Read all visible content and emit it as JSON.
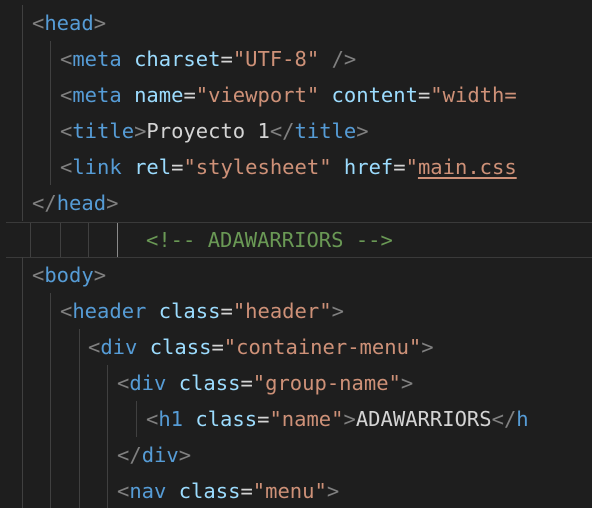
{
  "editor": {
    "lines": [
      [
        [
          "punct",
          "<"
        ],
        [
          "tag",
          "head"
        ],
        [
          "punct",
          ">"
        ]
      ],
      [
        [
          "punct",
          "<"
        ],
        [
          "tag",
          "meta"
        ],
        [
          "text",
          " "
        ],
        [
          "attr",
          "charset"
        ],
        [
          "eq",
          "="
        ],
        [
          "str",
          "\"UTF-8\""
        ],
        [
          "text",
          " "
        ],
        [
          "punct",
          "/>"
        ]
      ],
      [
        [
          "punct",
          "<"
        ],
        [
          "tag",
          "meta"
        ],
        [
          "text",
          " "
        ],
        [
          "attr",
          "name"
        ],
        [
          "eq",
          "="
        ],
        [
          "str",
          "\"viewport\""
        ],
        [
          "text",
          " "
        ],
        [
          "attr",
          "content"
        ],
        [
          "eq",
          "="
        ],
        [
          "str",
          "\"width="
        ]
      ],
      [
        [
          "punct",
          "<"
        ],
        [
          "tag",
          "title"
        ],
        [
          "punct",
          ">"
        ],
        [
          "text",
          "Proyecto 1"
        ],
        [
          "punct",
          "</"
        ],
        [
          "tag",
          "title"
        ],
        [
          "punct",
          ">"
        ]
      ],
      [
        [
          "punct",
          "<"
        ],
        [
          "tag",
          "link"
        ],
        [
          "text",
          " "
        ],
        [
          "attr",
          "rel"
        ],
        [
          "eq",
          "="
        ],
        [
          "str",
          "\"stylesheet\""
        ],
        [
          "text",
          " "
        ],
        [
          "attr",
          "href"
        ],
        [
          "eq",
          "="
        ],
        [
          "str",
          "\""
        ],
        [
          "link",
          "main.css"
        ]
      ],
      [
        [
          "punct",
          "</"
        ],
        [
          "tag",
          "head"
        ],
        [
          "punct",
          ">"
        ]
      ],
      [
        [
          "comment",
          "<!-- ADAWARRIORS -->"
        ]
      ],
      [
        [
          "punct",
          "<"
        ],
        [
          "tag",
          "body"
        ],
        [
          "punct",
          ">"
        ]
      ],
      [
        [
          "punct",
          "<"
        ],
        [
          "tag",
          "header"
        ],
        [
          "text",
          " "
        ],
        [
          "attr",
          "class"
        ],
        [
          "eq",
          "="
        ],
        [
          "str",
          "\"header\""
        ],
        [
          "punct",
          ">"
        ]
      ],
      [
        [
          "punct",
          "<"
        ],
        [
          "tag",
          "div"
        ],
        [
          "text",
          " "
        ],
        [
          "attr",
          "class"
        ],
        [
          "eq",
          "="
        ],
        [
          "str",
          "\"container-menu\""
        ],
        [
          "punct",
          ">"
        ]
      ],
      [
        [
          "punct",
          "<"
        ],
        [
          "tag",
          "div"
        ],
        [
          "text",
          " "
        ],
        [
          "attr",
          "class"
        ],
        [
          "eq",
          "="
        ],
        [
          "str",
          "\"group-name\""
        ],
        [
          "punct",
          ">"
        ]
      ],
      [
        [
          "punct",
          "<"
        ],
        [
          "tag",
          "h1"
        ],
        [
          "text",
          " "
        ],
        [
          "attr",
          "class"
        ],
        [
          "eq",
          "="
        ],
        [
          "str",
          "\"name\""
        ],
        [
          "punct",
          ">"
        ],
        [
          "text",
          "ADAWARRIORS"
        ],
        [
          "punct",
          "</"
        ],
        [
          "tag",
          "h"
        ]
      ],
      [
        [
          "punct",
          "</"
        ],
        [
          "tag",
          "div"
        ],
        [
          "punct",
          ">"
        ]
      ],
      [
        [
          "punct",
          "<"
        ],
        [
          "tag",
          "nav"
        ],
        [
          "text",
          " "
        ],
        [
          "attr",
          "class"
        ],
        [
          "eq",
          "="
        ],
        [
          "str",
          "\"menu\""
        ],
        [
          "punct",
          ">"
        ]
      ]
    ]
  }
}
